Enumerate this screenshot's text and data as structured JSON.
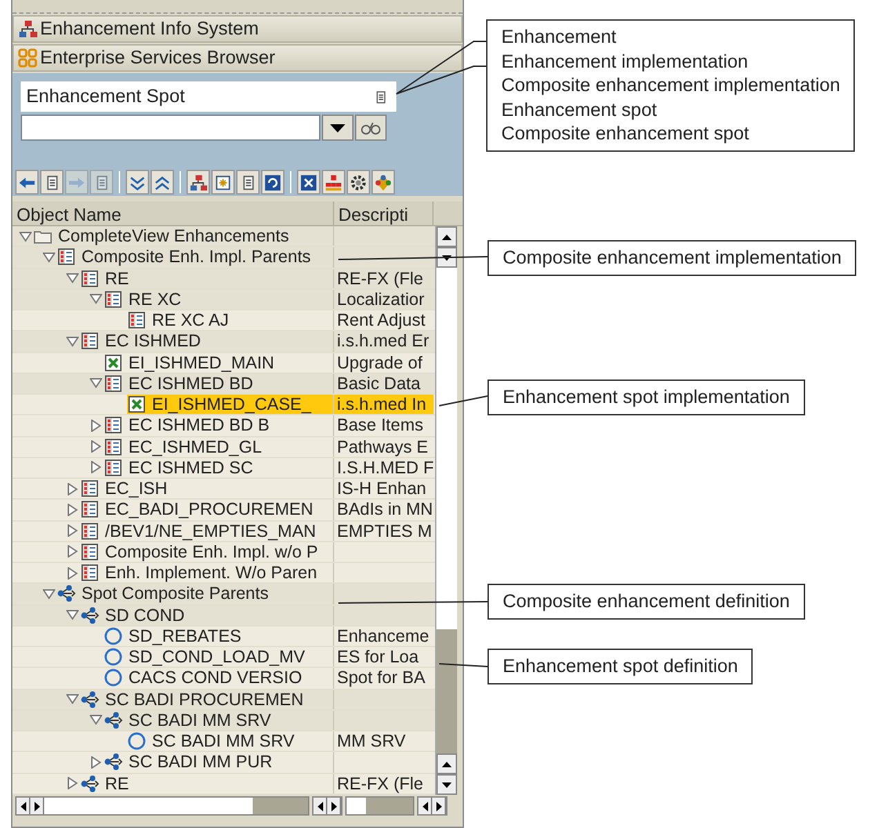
{
  "nav_bars": [
    {
      "label": "Enhancement Info System",
      "kind": "hierarchy"
    },
    {
      "label": "Enterprise Services Browser",
      "kind": "grid"
    }
  ],
  "object_type_field": {
    "value": "Enhancement Spot"
  },
  "toolbar": [
    {
      "kind": "back",
      "disabled": false
    },
    {
      "kind": "doc",
      "disabled": false
    },
    {
      "kind": "forward",
      "disabled": true
    },
    {
      "kind": "doc",
      "disabled": true
    },
    {
      "kind": "separator"
    },
    {
      "kind": "expand",
      "disabled": false
    },
    {
      "kind": "collapse",
      "disabled": false
    },
    {
      "kind": "separator"
    },
    {
      "kind": "hierarchy",
      "disabled": false
    },
    {
      "kind": "new",
      "disabled": false
    },
    {
      "kind": "doc",
      "disabled": false
    },
    {
      "kind": "refresh",
      "disabled": false
    },
    {
      "kind": "separator"
    },
    {
      "kind": "close",
      "disabled": false
    },
    {
      "kind": "org",
      "disabled": false
    },
    {
      "kind": "gear",
      "disabled": false
    },
    {
      "kind": "move",
      "disabled": false
    }
  ],
  "tree": {
    "columns": [
      "Object Name",
      "Descripti"
    ],
    "rows": [
      {
        "name": "CompleteView Enhancements",
        "kind": "folder",
        "expanded": true,
        "selected": false,
        "children": [
          {
            "name": "Composite Enh. Impl. Parents",
            "kind": "composite_impl",
            "expanded": true,
            "selected": false,
            "children": [
              {
                "name": "RE",
                "description": "RE-FX (Fle",
                "kind": "composite_impl",
                "expanded": true,
                "selected": false,
                "children": [
                  {
                    "name": "RE XC",
                    "description": "Localizatior",
                    "kind": "composite_impl",
                    "expanded": true,
                    "selected": false,
                    "children": [
                      {
                        "name": "RE XC AJ",
                        "description": "Rent Adjust",
                        "kind": "composite_impl",
                        "selected": false
                      }
                    ]
                  }
                ]
              },
              {
                "name": "EC ISHMED",
                "description": "i.s.h.med Er",
                "kind": "composite_impl",
                "expanded": true,
                "selected": false,
                "children": [
                  {
                    "name": "EI_ISHMED_MAIN",
                    "description": "Upgrade of",
                    "kind": "impl",
                    "selected": false
                  },
                  {
                    "name": "EC ISHMED BD",
                    "description": "Basic Data",
                    "kind": "composite_impl",
                    "expanded": true,
                    "selected": false,
                    "children": [
                      {
                        "name": "EI_ISHMED_CASE_",
                        "description": "i.s.h.med In",
                        "kind": "impl",
                        "selected": true
                      }
                    ]
                  },
                  {
                    "name": "EC ISHMED BD B",
                    "description": "Base Items",
                    "kind": "composite_impl",
                    "expanded": false,
                    "selected": false
                  },
                  {
                    "name": "EC_ISHMED_GL",
                    "description": "Pathways E",
                    "kind": "composite_impl",
                    "expanded": false,
                    "selected": false
                  },
                  {
                    "name": "EC ISHMED SC",
                    "description": "I.S.H.MED F",
                    "kind": "composite_impl",
                    "expanded": false,
                    "selected": false
                  }
                ]
              },
              {
                "name": "EC_ISH",
                "description": "IS-H Enhan",
                "kind": "composite_impl",
                "expanded": false,
                "selected": false
              },
              {
                "name": "EC_BADI_PROCUREMEN",
                "description": "BAdIs in MN",
                "kind": "composite_impl",
                "expanded": false,
                "selected": false
              },
              {
                "name": "/BEV1/NE_EMPTIES_MAN",
                "description": "EMPTIES M",
                "kind": "composite_impl",
                "expanded": false,
                "selected": false
              },
              {
                "name": "Composite Enh. Impl. w/o P",
                "kind": "composite_impl",
                "expanded": false,
                "selected": false
              },
              {
                "name": "Enh. Implement. W/o Paren",
                "kind": "composite_impl",
                "expanded": false,
                "selected": false
              }
            ]
          },
          {
            "name": "Spot Composite Parents",
            "kind": "composite_spot",
            "expanded": true,
            "selected": false,
            "children": [
              {
                "name": "SD COND",
                "kind": "composite_spot",
                "expanded": true,
                "selected": false,
                "children": [
                  {
                    "name": "SD_REBATES",
                    "description": "Enhanceme",
                    "kind": "spot",
                    "selected": false
                  },
                  {
                    "name": "SD_COND_LOAD_MV",
                    "description": "ES for Loa",
                    "kind": "spot",
                    "selected": false
                  },
                  {
                    "name": "CACS COND VERSIO",
                    "description": "Spot for BA",
                    "kind": "spot",
                    "selected": false
                  }
                ]
              },
              {
                "name": "SC BADI PROCUREMEN",
                "kind": "composite_spot",
                "expanded": true,
                "selected": false,
                "children": [
                  {
                    "name": "SC BADI MM SRV",
                    "kind": "composite_spot",
                    "expanded": true,
                    "selected": false,
                    "children": [
                      {
                        "name": "SC BADI MM SRV",
                        "description": "MM SRV",
                        "kind": "spot",
                        "selected": false
                      }
                    ]
                  },
                  {
                    "name": "SC BADI MM PUR",
                    "kind": "composite_spot",
                    "expanded": false,
                    "selected": false
                  }
                ]
              },
              {
                "name": "RE",
                "description": "RE-FX (Fle",
                "kind": "composite_spot",
                "expanded": false,
                "selected": false
              }
            ]
          }
        ]
      }
    ]
  },
  "callouts": [
    {
      "lines": [
        "Enhancement",
        "Enhancement implementation",
        "Composite enhancement implementation",
        "Enhancement spot",
        "Composite enhancement spot"
      ]
    },
    {
      "lines": [
        "Composite enhancement implementation"
      ]
    },
    {
      "lines": [
        "Enhancement spot implementation"
      ]
    },
    {
      "lines": [
        "Composite enhancement definition"
      ]
    },
    {
      "lines": [
        "Enhancement spot definition"
      ]
    }
  ]
}
